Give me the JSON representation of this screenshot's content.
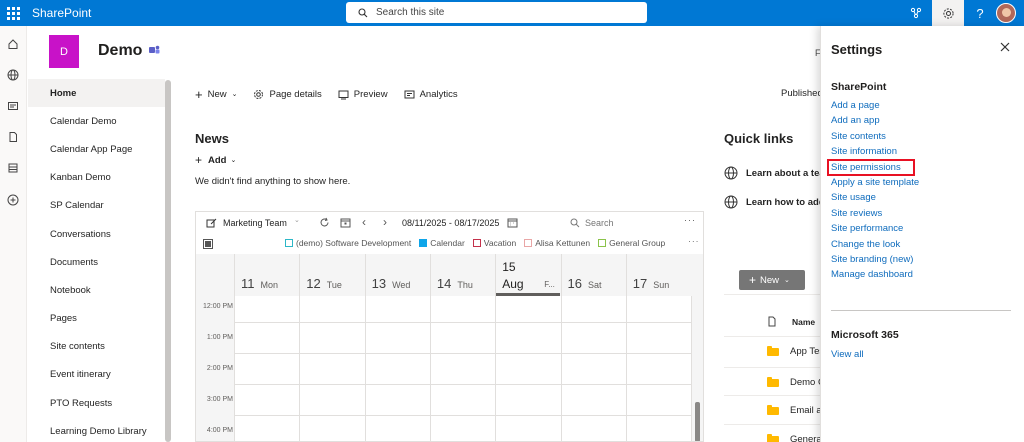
{
  "suite_bar": {
    "app_name": "SharePoint",
    "search_placeholder": "Search this site"
  },
  "site": {
    "logo_letter": "D",
    "title": "Demo",
    "header_fragment": "F"
  },
  "left_nav": {
    "items": [
      {
        "label": "Home",
        "active": true
      },
      {
        "label": "Calendar Demo"
      },
      {
        "label": "Calendar App Page"
      },
      {
        "label": "Kanban Demo"
      },
      {
        "label": "SP Calendar"
      },
      {
        "label": "Conversations"
      },
      {
        "label": "Documents"
      },
      {
        "label": "Notebook"
      },
      {
        "label": "Pages"
      },
      {
        "label": "Site contents"
      },
      {
        "label": "Event itinerary"
      },
      {
        "label": "PTO Requests"
      },
      {
        "label": "Learning Demo Library"
      }
    ]
  },
  "command_bar": {
    "new_label": "New",
    "page_details_label": "Page details",
    "preview_label": "Preview",
    "analytics_label": "Analytics",
    "status_fragment": "Published"
  },
  "news": {
    "title": "News",
    "add_label": "Add",
    "empty_message": "We didn't find anything to show here."
  },
  "calendar": {
    "calendar_name": "Marketing Team",
    "date_range": "08/11/2025 - 08/17/2025",
    "search_placeholder": "Search",
    "legend": [
      {
        "label": "(demo) Software Development",
        "color": "#2cb7c7",
        "filled": false
      },
      {
        "label": "Calendar",
        "color": "#0ea5e9",
        "filled": true
      },
      {
        "label": "Vacation",
        "color": "#c4314b",
        "filled": false
      },
      {
        "label": "Alisa Kettunen",
        "color": "#e9a6a6",
        "filled": false
      },
      {
        "label": "General Group",
        "color": "#8bc34a",
        "filled": false
      }
    ],
    "days": [
      {
        "num": "11",
        "name": "Mon"
      },
      {
        "num": "12",
        "name": "Tue"
      },
      {
        "num": "13",
        "name": "Wed"
      },
      {
        "num": "14",
        "name": "Thu"
      },
      {
        "num": "15",
        "name": "Aug",
        "extra": "F...",
        "today": true
      },
      {
        "num": "16",
        "name": "Sat"
      },
      {
        "num": "17",
        "name": "Sun"
      }
    ],
    "times": [
      "12:00 PM",
      "1:00 PM",
      "2:00 PM",
      "3:00 PM",
      "4:00 PM"
    ]
  },
  "quick_links": {
    "title": "Quick links",
    "items": [
      {
        "label": "Learn about a tear"
      },
      {
        "label": "Learn how to add"
      }
    ]
  },
  "documents": {
    "new_label": "New",
    "name_header": "Name",
    "rows": [
      "App Tes",
      "Demo C",
      "Email a",
      "Genera"
    ]
  },
  "settings_panel": {
    "title": "Settings",
    "sharepoint_section": "SharePoint",
    "links": [
      "Add a page",
      "Add an app",
      "Site contents",
      "Site information",
      "Site permissions",
      "Apply a site template",
      "Site usage",
      "Site reviews",
      "Site performance",
      "Change the look",
      "Site branding (new)",
      "Manage dashboard"
    ],
    "highlighted_link": "Site permissions",
    "m365_section": "Microsoft 365",
    "m365_link": "View all"
  },
  "colors": {
    "suite_bar": "#0078d4",
    "site_logo": "#c812c8",
    "link": "#0f6cbd",
    "highlight_box": "#e81123"
  }
}
